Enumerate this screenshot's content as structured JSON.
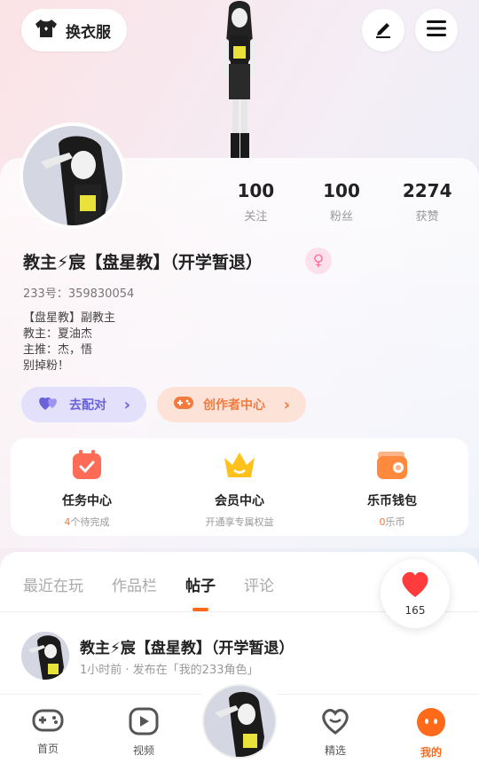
{
  "topbar": {
    "outfit_label": "换衣服",
    "icons": [
      "tshirt-icon",
      "pen-icon",
      "menu-icon"
    ]
  },
  "profile": {
    "stats": [
      {
        "value": "100",
        "label": "关注"
      },
      {
        "value": "100",
        "label": "粉丝"
      },
      {
        "value": "2274",
        "label": "获赞"
      }
    ],
    "username": "教主⚡宸【盘星教】（开学暂退）",
    "gender_symbol": "♀",
    "uid": "233号：359830054",
    "bio": [
      "【盘星教】副教主",
      "教主：夏油杰",
      "主推：杰，悟",
      "别掉粉！"
    ],
    "match_label": "去配对",
    "creator_label": "创作者中心"
  },
  "features": [
    {
      "title": "任务中心",
      "sub_highlight": "4",
      "sub_text": "个待完成"
    },
    {
      "title": "会员中心",
      "sub_highlight": "",
      "sub_text": "开通享专属权益"
    },
    {
      "title": "乐币钱包",
      "sub_highlight": "0",
      "sub_text": "乐币"
    }
  ],
  "tabs": [
    "最近在玩",
    "作品栏",
    "帖子",
    "评论"
  ],
  "active_tab": "帖子",
  "like_count": "165",
  "post": {
    "author": "教主⚡宸【盘星教】（开学暂退）",
    "meta": "1小时前 · 发布在「我的233角色」"
  },
  "bottom_nav": [
    {
      "label": "首页",
      "icon": "gamepad-icon"
    },
    {
      "label": "视频",
      "icon": "play-icon"
    },
    {
      "label": "精选",
      "icon": "heart-chat-icon"
    },
    {
      "label": "我的",
      "icon": "face-icon"
    }
  ],
  "colors": {
    "accent": "#ff6a1a",
    "match": "#6b62d9",
    "creator": "#f27a3e",
    "female": "#ff6e9e"
  }
}
